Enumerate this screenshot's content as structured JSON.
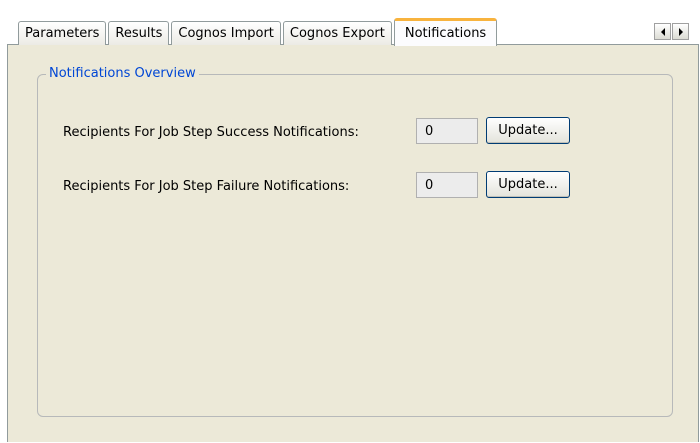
{
  "tabs": [
    {
      "label": "Parameters",
      "active": false
    },
    {
      "label": "Results",
      "active": false
    },
    {
      "label": "Cognos Import",
      "active": false
    },
    {
      "label": "Cognos Export",
      "active": false
    },
    {
      "label": "Notifications",
      "active": true
    }
  ],
  "group": {
    "title": "Notifications Overview"
  },
  "success_row": {
    "label": "Recipients For Job Step Success Notifications:",
    "count": "0",
    "button_label": "Update..."
  },
  "failure_row": {
    "label": "Recipients For Job Step Failure Notifications:",
    "count": "0",
    "button_label": "Update..."
  },
  "colors": {
    "active_tab_accent": "#f8b33e",
    "group_title": "#0046d5",
    "panel_background": "#ece9d8"
  },
  "icons": {
    "scroll_left": "chevron-left-icon",
    "scroll_right": "chevron-right-icon"
  }
}
